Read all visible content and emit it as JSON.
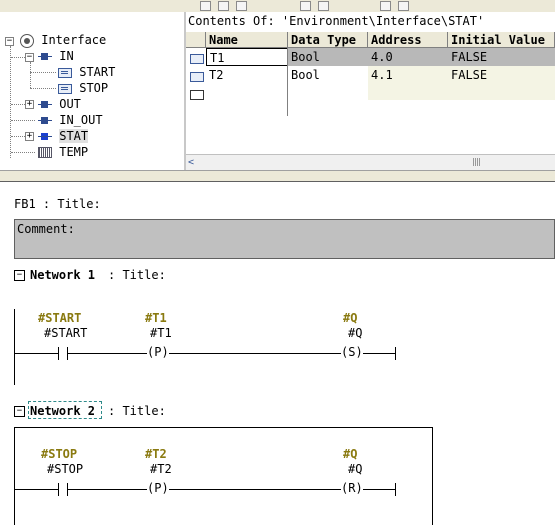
{
  "tree": {
    "root": "Interface",
    "items": [
      {
        "label": "IN",
        "children": [
          "START",
          "STOP"
        ]
      },
      {
        "label": "OUT"
      },
      {
        "label": "IN_OUT"
      },
      {
        "label": "STAT"
      },
      {
        "label": "TEMP"
      }
    ]
  },
  "contents": {
    "title": "Contents Of: 'Environment\\Interface\\STAT'",
    "headers": [
      "Name",
      "Data Type",
      "Address",
      "Initial Value"
    ],
    "rows": [
      {
        "name": "T1",
        "type": "Bool",
        "address": "4.0",
        "initial": "FALSE"
      },
      {
        "name": "T2",
        "type": "Bool",
        "address": "4.1",
        "initial": "FALSE"
      }
    ]
  },
  "editor": {
    "block_title": "FB1 : Title:",
    "comment_label": "Comment:",
    "networks": [
      {
        "header_bold": "Network 1",
        "header_rest": ": Title:",
        "contact_sym": "#START",
        "contact_lbl": "#START",
        "p_sym": "#T1",
        "p_lbl": "#T1",
        "p_coil": "P",
        "out_sym": "#Q",
        "out_lbl": "#Q",
        "out_coil": "S"
      },
      {
        "header_bold": "Network 2",
        "header_rest": ": Title:",
        "contact_sym": "#STOP",
        "contact_lbl": "#STOP",
        "p_sym": "#T2",
        "p_lbl": "#T2",
        "p_coil": "P",
        "out_sym": "#Q",
        "out_lbl": "#Q",
        "out_coil": "R"
      }
    ]
  }
}
